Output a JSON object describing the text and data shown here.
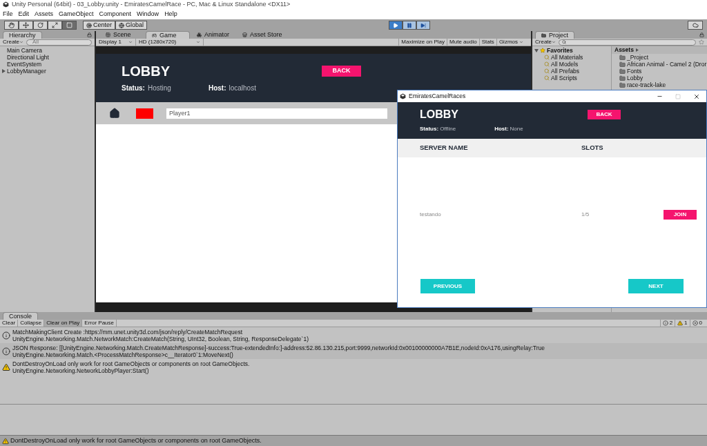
{
  "window": {
    "title": "Unity Personal (64bit) - 03_Lobby.unity - EmiratesCamelRace - PC, Mac & Linux Standalone <DX11>"
  },
  "menu": [
    "File",
    "Edit",
    "Assets",
    "GameObject",
    "Component",
    "Window",
    "Help"
  ],
  "toolbar": {
    "tools": [
      {
        "kind": "hand",
        "selected": false
      },
      {
        "kind": "move",
        "selected": false
      },
      {
        "kind": "rotate",
        "selected": false
      },
      {
        "kind": "scale",
        "selected": false
      },
      {
        "kind": "rect",
        "selected": true
      }
    ],
    "pivot": [
      {
        "kind": "center",
        "label": "Center"
      },
      {
        "kind": "global",
        "label": "Global"
      }
    ],
    "playback": [
      {
        "kind": "play",
        "selected": true
      },
      {
        "kind": "pause",
        "selected": false
      },
      {
        "kind": "step",
        "selected": false
      }
    ]
  },
  "hierarchy": {
    "tab": "Hierarchy",
    "create": "Create",
    "search": {
      "placeholder": "All"
    },
    "items": [
      {
        "label": "Main Camera",
        "expandable": false
      },
      {
        "label": "Directional Light",
        "expandable": false
      },
      {
        "label": "EventSystem",
        "expandable": false
      },
      {
        "label": "LobbyManager",
        "expandable": true
      }
    ]
  },
  "game_view": {
    "tabs": [
      {
        "label": "Scene",
        "kind": "scene",
        "selected": false
      },
      {
        "label": "Game",
        "kind": "game",
        "selected": true
      },
      {
        "label": "Animator",
        "kind": "animator",
        "selected": false
      },
      {
        "label": "Asset Store",
        "kind": "store",
        "selected": false
      }
    ],
    "display": "Display 1",
    "resolution": "HD (1280x720)",
    "toggles": [
      "Maximize on Play",
      "Mute audio",
      "Stats"
    ],
    "gizmos": "Gizmos",
    "lobby": {
      "title": "LOBBY",
      "back": "BACK",
      "status_label": "Status:",
      "status": "Hosting",
      "host_label": "Host:",
      "host": "localhost",
      "player_name": "Player1"
    }
  },
  "project": {
    "tab": "Project",
    "create": "Create",
    "favorites": {
      "label": "Favorites",
      "expanded": true,
      "items": [
        "All Materials",
        "All Models",
        "All Prefabs",
        "All Scripts"
      ]
    },
    "assets_header": "Assets",
    "folders": [
      "_Project",
      "African Animal - Camel 2 (Dror",
      "Fonts",
      "Lobby",
      "race-track-lake"
    ]
  },
  "game_window": {
    "title": "EmiratesCamelRaces",
    "lobby_title": "LOBBY",
    "back": "BACK",
    "status_label": "Status:",
    "status": "Offline",
    "host_label": "Host:",
    "host": "None",
    "columns": [
      "SERVER NAME",
      "SLOTS"
    ],
    "servers": [
      {
        "name": "testando",
        "slots": "1/5",
        "join": "JOIN"
      }
    ],
    "previous": "PREVIOUS",
    "next": "NEXT"
  },
  "console": {
    "tab": "Console",
    "buttons": [
      {
        "label": "Clear",
        "selected": false
      },
      {
        "label": "Collapse",
        "selected": false
      },
      {
        "label": "Clear on Play",
        "selected": true
      },
      {
        "label": "Error Pause",
        "selected": false
      }
    ],
    "counts": [
      {
        "kind": "info",
        "count": "2"
      },
      {
        "kind": "warning",
        "count": "1"
      },
      {
        "kind": "error",
        "count": "0"
      }
    ],
    "messages": [
      {
        "kind": "info",
        "lines": [
          "MatchMakingClient Create :https://mm.unet.unity3d.com/json/reply/CreateMatchRequest",
          "UnityEngine.Networking.Match.NetworkMatch:CreateMatch(String, UInt32, Boolean, String, ResponseDelegate`1)"
        ]
      },
      {
        "kind": "info",
        "lines": [
          "JSON Response: [[UnityEngine.Networking.Match.CreateMatchResponse]-success:True-extendedInfo:]-address:52.86.130.215,port:9999,networkId:0x00100000000A7B1E,nodeId:0xA176,usingRelay:True",
          "UnityEngine.Networking.Match.<ProcessMatchResponse>c__Iterator0`1:MoveNext()"
        ]
      },
      {
        "kind": "warning",
        "lines": [
          "DontDestroyOnLoad only work for root GameObjects or components on root GameObjects.",
          "UnityEngine.Networking.NetworkLobbyPlayer:Start()"
        ]
      }
    ]
  },
  "status_bar": {
    "kind": "warning",
    "text": "DontDestroyOnLoad only work for root GameObjects or components on root GameObjects."
  }
}
